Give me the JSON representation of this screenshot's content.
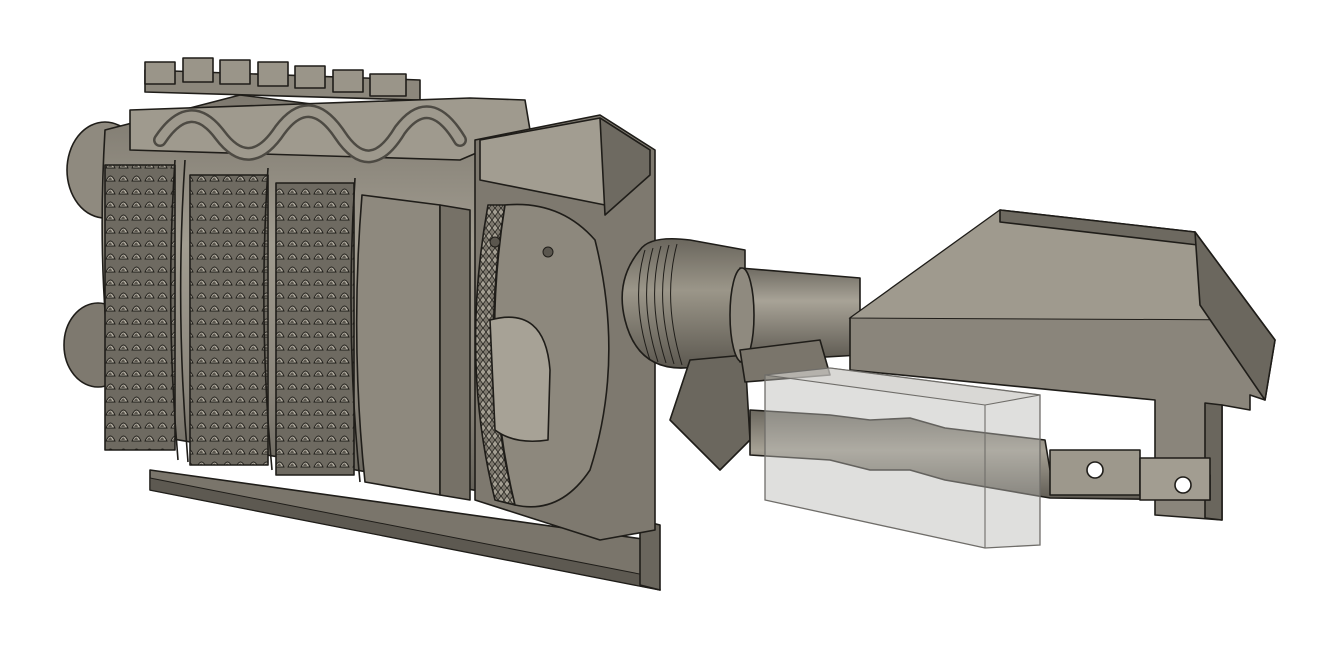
{
  "scene": {
    "subject": "cad-render-mechanical-assembly",
    "background": "#ffffff",
    "colors": {
      "body": "#8a857b",
      "body_light": "#a9a498",
      "body_dark": "#625e55",
      "body_darker": "#4a4740",
      "edge": "#1f1d19",
      "transparent_box": "#b9b7b3"
    },
    "parts": [
      "drum-assembly-icon",
      "top-rail-icon",
      "base-rail-icon",
      "gear-ring-icon",
      "threaded-collar-icon",
      "barrel-icon",
      "bracket-icon",
      "transparent-box-icon",
      "shaft-icon"
    ]
  }
}
